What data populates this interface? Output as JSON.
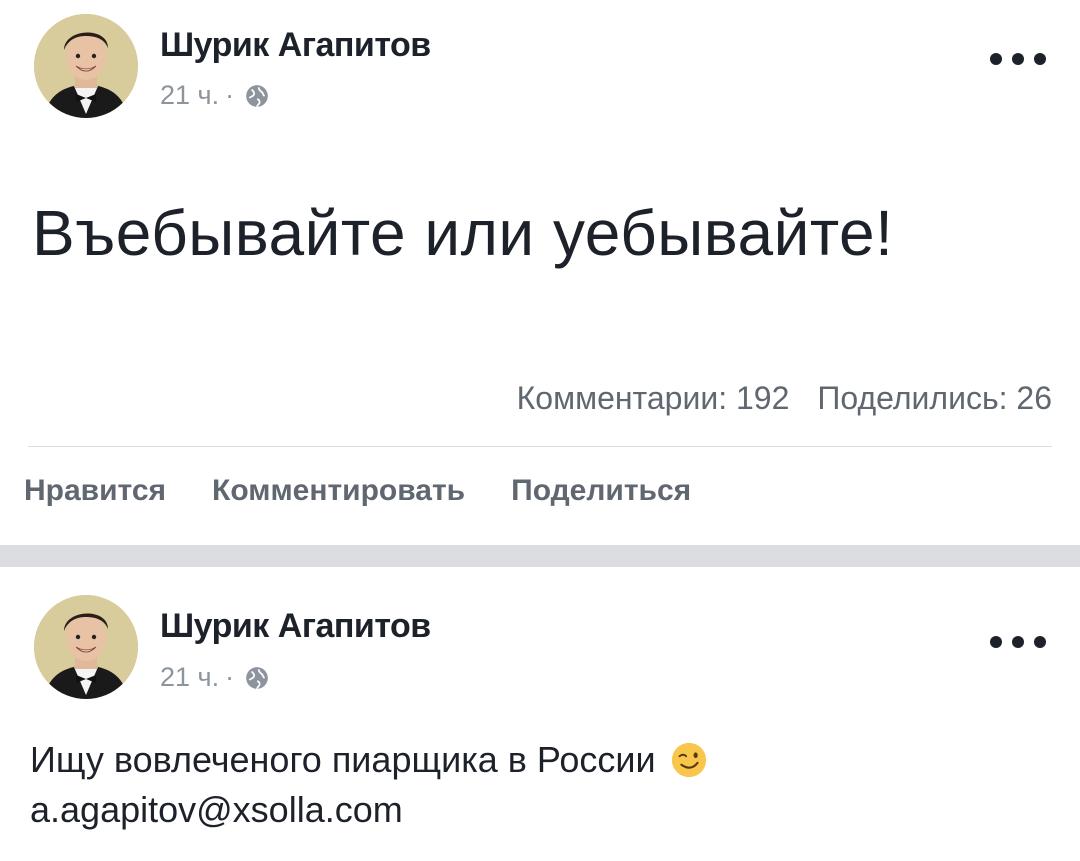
{
  "posts": [
    {
      "author": "Шурик Агапитов",
      "time": "21 ч.",
      "meta_separator": "·",
      "privacy_icon": "globe-icon",
      "text": "Въебывайте или уебывайте!",
      "comments_label": "Комментарии: 192",
      "shares_label": "Поделились: 26",
      "actions": {
        "like": "Нравится",
        "comment": "Комментировать",
        "share": "Поделиться"
      }
    },
    {
      "author": "Шурик Агапитов",
      "time": "21 ч.",
      "meta_separator": "·",
      "privacy_icon": "globe-icon",
      "text_line_1": "Ищу вовлеченого пиарщика в России",
      "emoji": "wink-icon",
      "email": "a.agapitov@xsolla.com"
    }
  ],
  "colors": {
    "text_primary": "#1d2129",
    "text_secondary": "#8d949e",
    "action_text": "#606770",
    "separator": "#dcdde1"
  }
}
